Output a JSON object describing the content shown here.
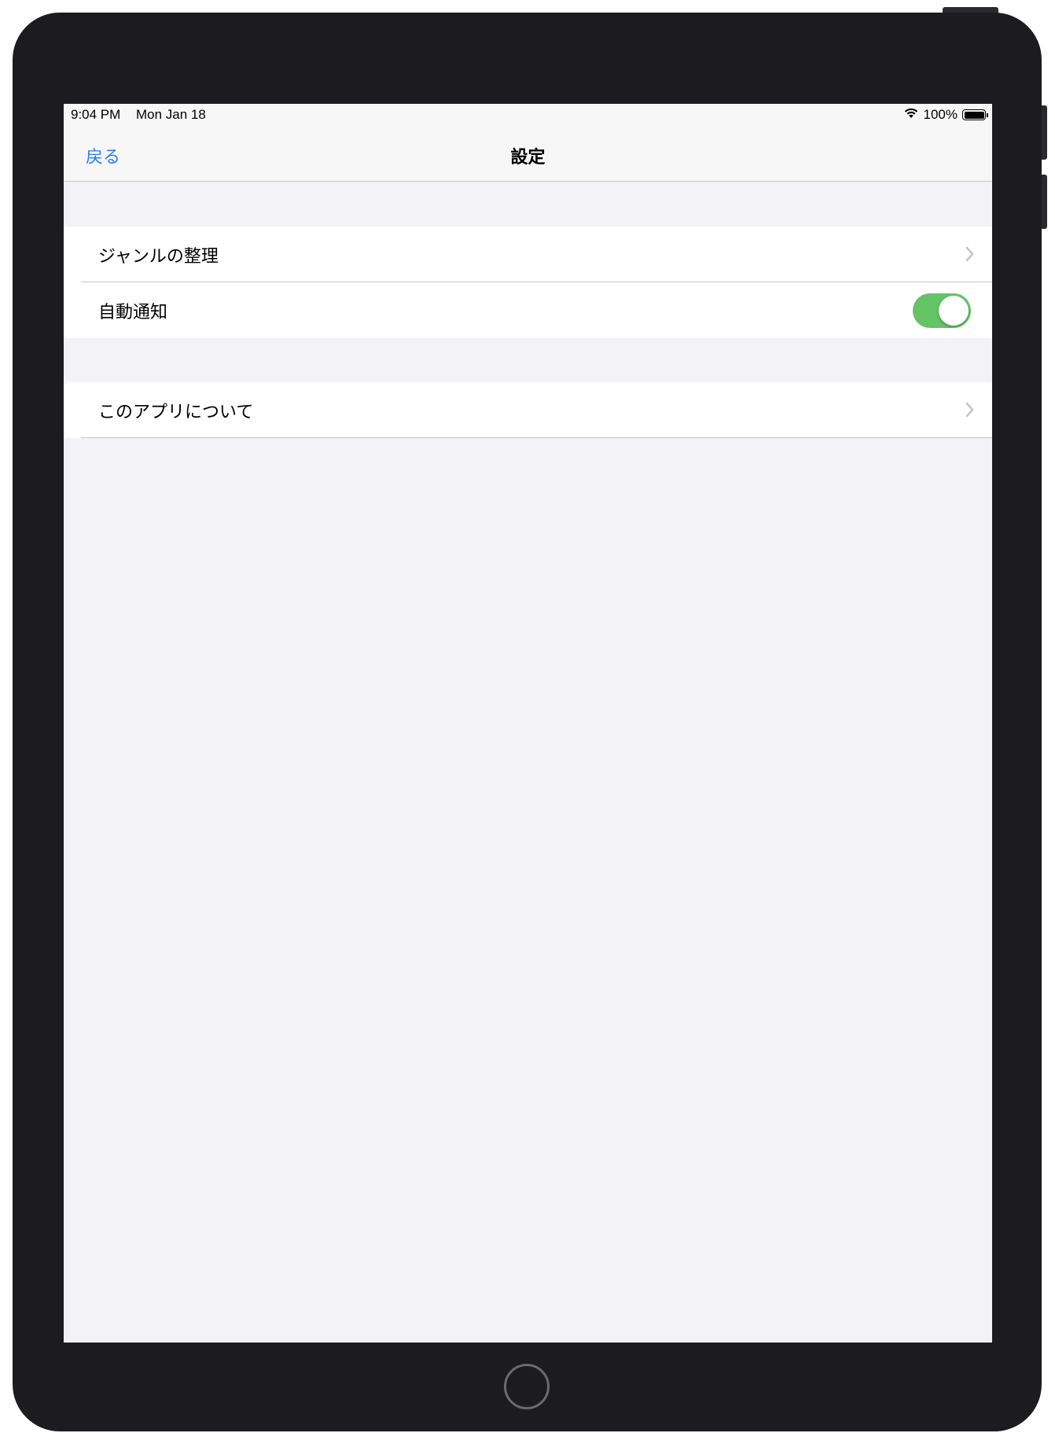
{
  "status_bar": {
    "time": "9:04 PM",
    "date": "Mon Jan 18",
    "battery_percent": "100%",
    "wifi_icon": "wifi-icon",
    "battery_icon": "battery-full-icon"
  },
  "nav": {
    "back_label": "戻る",
    "title": "設定"
  },
  "sections": [
    {
      "rows": [
        {
          "label": "ジャンルの整理",
          "accessory": "chevron-right-icon"
        },
        {
          "label": "自動通知",
          "accessory": "toggle",
          "toggle_on": true
        }
      ]
    },
    {
      "rows": [
        {
          "label": "このアプリについて",
          "accessory": "chevron-right-icon"
        }
      ]
    }
  ],
  "colors": {
    "accent": "#2f7cf6",
    "toggle_on": "#65c466",
    "background": "#f2f2f7",
    "frame": "#1c1c1e"
  }
}
